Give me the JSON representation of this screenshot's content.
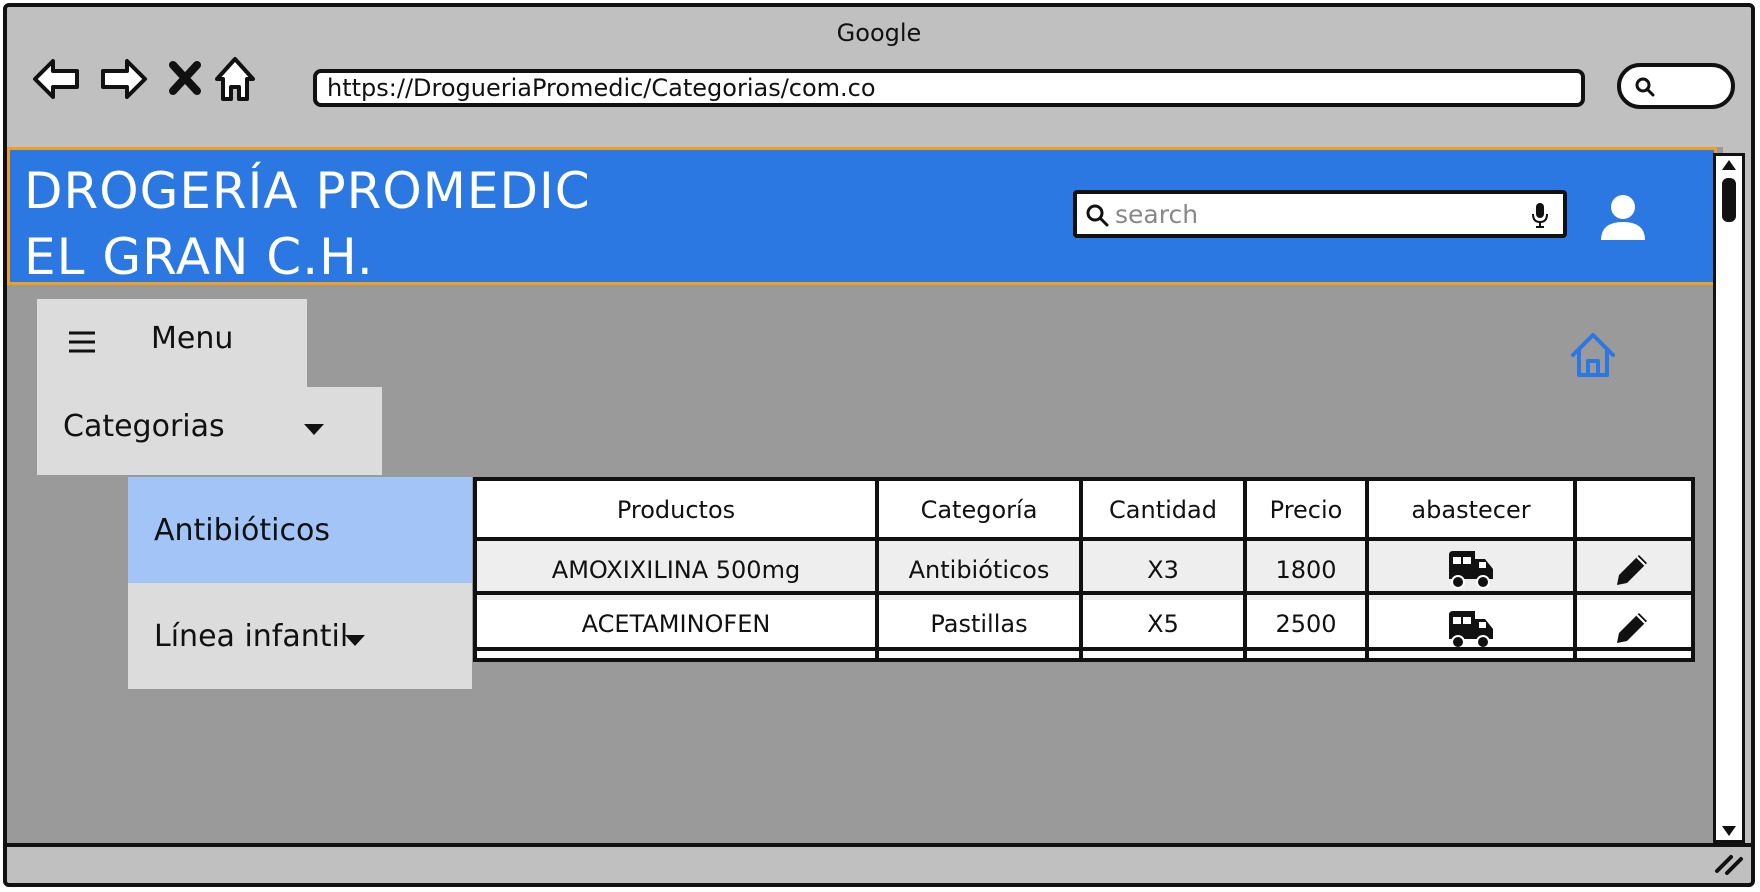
{
  "browser": {
    "title": "Google",
    "url": "https://DrogueriaPromedic/Categorias/com.co"
  },
  "header": {
    "brand_line1": "DROGERÍA PROMEDIC",
    "brand_line2": "EL GRAN C.H.",
    "search_placeholder": "search",
    "accent_color": "#2c78e3",
    "border_color": "#f0a020"
  },
  "nav": {
    "menu_label": "Menu",
    "categories_label": "Categorias",
    "sub_items": [
      {
        "label": "Antibióticos",
        "active": true
      },
      {
        "label": "Línea infantil",
        "has_submenu": true
      }
    ]
  },
  "table": {
    "headers": [
      "Productos",
      "Categoría",
      "Cantidad",
      "Precio",
      "abastecer"
    ],
    "rows": [
      {
        "producto": "AMOXIXILINA 500mg",
        "categoria": "Antibióticos",
        "cantidad": "X3",
        "precio": "1800",
        "action_icon": "truck-icon",
        "edit_icon": "pencil-icon"
      },
      {
        "producto": "ACETAMINOFEN",
        "categoria": "Pastillas",
        "cantidad": "X5",
        "precio": "2500",
        "action_icon": "truck-icon",
        "edit_icon": "pencil-icon"
      }
    ]
  },
  "icons": [
    "back-icon",
    "forward-icon",
    "close-icon",
    "home-icon",
    "search-icon",
    "microphone-icon",
    "user-icon",
    "hamburger-icon",
    "chevron-down-icon",
    "truck-icon",
    "pencil-icon"
  ]
}
